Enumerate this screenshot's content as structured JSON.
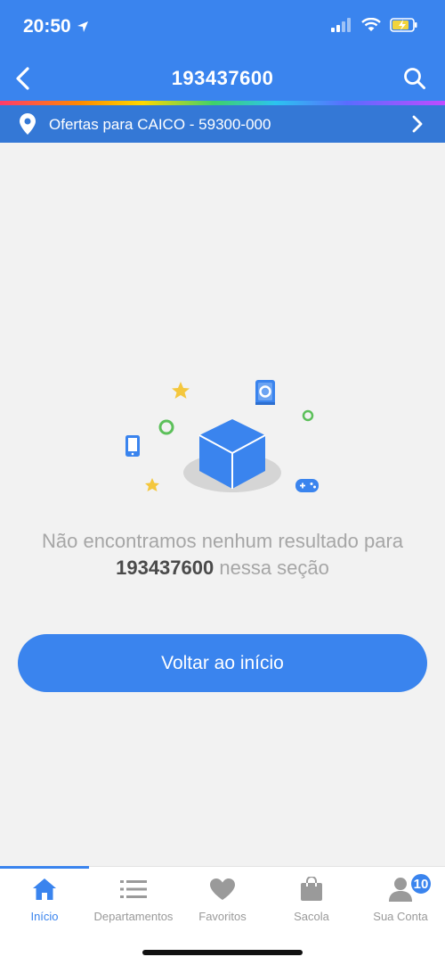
{
  "status_bar": {
    "time": "20:50"
  },
  "header": {
    "title": "193437600"
  },
  "location": {
    "text": "Ofertas para CAICO - 59300-000"
  },
  "empty_state": {
    "message_before": "Não encontramos nenhum resultado para",
    "query": "193437600",
    "message_after": "nessa seção"
  },
  "primary_button": {
    "label": "Voltar ao início"
  },
  "tabs": [
    {
      "label": "Início",
      "icon": "home-icon",
      "active": true
    },
    {
      "label": "Departamentos",
      "icon": "list-icon"
    },
    {
      "label": "Favoritos",
      "icon": "heart-icon"
    },
    {
      "label": "Sacola",
      "icon": "bag-icon"
    },
    {
      "label": "Sua Conta",
      "icon": "user-icon",
      "badge": "10"
    }
  ],
  "colors": {
    "primary": "#3a84ee",
    "location_bar": "#3478d6",
    "background": "#f2f2f2",
    "tab_inactive": "#9a9a9a"
  }
}
